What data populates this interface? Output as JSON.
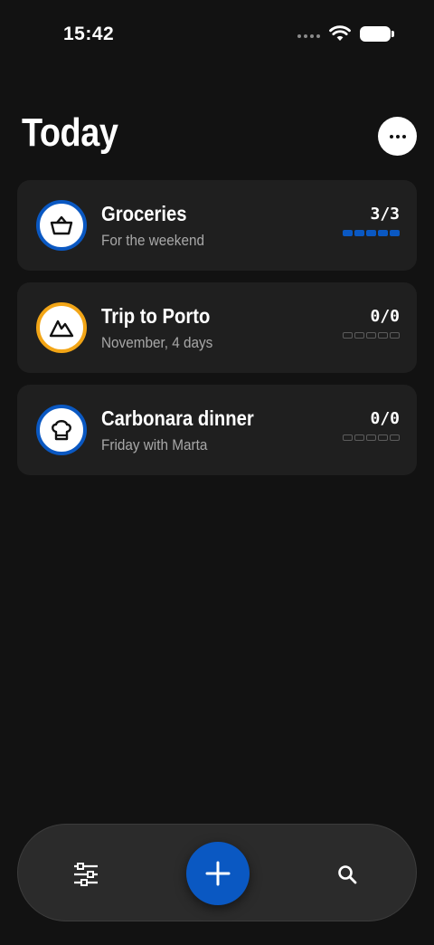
{
  "status_bar": {
    "time": "15:42"
  },
  "header": {
    "title": "Today"
  },
  "lists": [
    {
      "title": "Groceries",
      "subtitle": "For the weekend",
      "count": "3/3",
      "done": 3,
      "total": 3,
      "icon": "basket-icon",
      "ring_color": "#0a58c2"
    },
    {
      "title": "Trip to Porto",
      "subtitle": "November, 4 days",
      "count": "0/0",
      "done": 0,
      "total": 0,
      "icon": "mountain-icon",
      "ring_color": "#f2a516"
    },
    {
      "title": "Carbonara dinner",
      "subtitle": "Friday with Marta",
      "count": "0/0",
      "done": 0,
      "total": 0,
      "icon": "chef-hat-icon",
      "ring_color": "#0a58c2"
    }
  ],
  "bottom_bar": {
    "filter_icon": "sliders-icon",
    "add_icon": "plus-icon",
    "search_icon": "search-icon"
  },
  "colors": {
    "accent": "#0a58c2",
    "background": "#121212",
    "card": "#1f1f1f"
  }
}
